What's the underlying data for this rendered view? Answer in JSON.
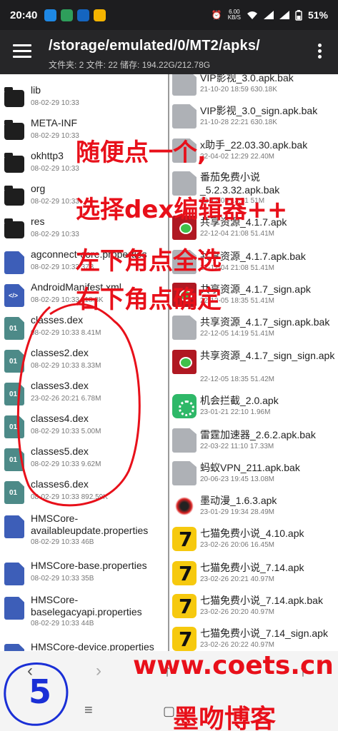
{
  "status_bar": {
    "time": "20:40",
    "speed_value": "6.00",
    "speed_unit": "KB/S",
    "battery": "51%"
  },
  "app_bar": {
    "path": "/storage/emulated/0/MT2/apks/",
    "info": "文件夹: 2  文件: 22  储存: 194.22G/212.78G"
  },
  "left_pane": {
    "items": [
      {
        "name": "lib",
        "meta": "08-02-29 10:33",
        "icon": "folder-icon"
      },
      {
        "name": "META-INF",
        "meta": "08-02-29 10:33",
        "icon": "folder-icon"
      },
      {
        "name": "okhttp3",
        "meta": "08-02-29 10:33",
        "icon": "folder-icon"
      },
      {
        "name": "org",
        "meta": "08-02-29 10:33",
        "icon": "folder-icon"
      },
      {
        "name": "res",
        "meta": "08-02-29 10:33",
        "icon": "folder-icon"
      },
      {
        "name": "agconnect-core.properties",
        "meta": "08-02-29 10:33  37B",
        "icon": "properties-file-icon"
      },
      {
        "name": "AndroidManifest.xml",
        "meta": "08-02-29 10:33  118.8K",
        "icon": "xml-file-icon"
      },
      {
        "name": "classes.dex",
        "meta": "08-02-29 10:33  8.41M",
        "icon": "dex-file-icon"
      },
      {
        "name": "classes2.dex",
        "meta": "08-02-29 10:33  8.33M",
        "icon": "dex-file-icon"
      },
      {
        "name": "classes3.dex",
        "meta": "23-02-26 20:21  6.78M",
        "icon": "dex-file-icon"
      },
      {
        "name": "classes4.dex",
        "meta": "08-02-29 10:33  5.00M",
        "icon": "dex-file-icon"
      },
      {
        "name": "classes5.dex",
        "meta": "08-02-29 10:33  9.62M",
        "icon": "dex-file-icon"
      },
      {
        "name": "classes6.dex",
        "meta": "08-02-29 10:33  892.59K",
        "icon": "dex-file-icon"
      },
      {
        "name": "HMSCore-availableupdate.properties",
        "meta": "08-02-29 10:33  46B",
        "icon": "properties-file-icon"
      },
      {
        "name": "HMSCore-base.properties",
        "meta": "08-02-29 10:33  35B",
        "icon": "properties-file-icon"
      },
      {
        "name": "HMSCore-baselegacyapi.properties",
        "meta": "08-02-29 10:33  44B",
        "icon": "properties-file-icon"
      },
      {
        "name": "HMSCore-device.properties",
        "meta": "",
        "icon": "properties-file-icon"
      }
    ]
  },
  "right_pane": {
    "items": [
      {
        "name": "VIP影视_3.0.apk.bak",
        "meta": "21-10-20 18:59  630.18K",
        "icon": "bak-file-icon"
      },
      {
        "name": "VIP影视_3.0_sign.apk.bak",
        "meta": "21-10-28 22:21  630.18K",
        "icon": "bak-file-icon"
      },
      {
        "name": "x助手_22.03.30.apk.bak",
        "meta": "22-04-02 12:29  22.40M",
        "icon": "bak-file-icon"
      },
      {
        "name": "番茄免费小说_5.2.3.32.apk.bak",
        "meta": "22-12-05 13:51  51M",
        "icon": "bak-file-icon"
      },
      {
        "name": "共享资源_4.1.7.apk",
        "meta": "22-12-04 21:08  51.41M",
        "icon": "share-app-icon"
      },
      {
        "name": "共享资源_4.1.7.apk.bak",
        "meta": "22-12-04 21:08  51.41M",
        "icon": "bak-file-icon"
      },
      {
        "name": "共享资源_4.1.7_sign.apk",
        "meta": "22-12-05 18:35  51.41M",
        "icon": "share-app-icon"
      },
      {
        "name": "共享资源_4.1.7_sign.apk.bak",
        "meta": "22-12-05 14:19  51.41M",
        "icon": "bak-file-icon"
      },
      {
        "name": "共享资源_4.1.7_sign_sign.apk",
        "meta": "22-12-05 18:35  51.42M",
        "icon": "share-app-icon"
      },
      {
        "name": "机会拦截_2.0.apk",
        "meta": "23-01-21 22:10  1.96M",
        "icon": "intercept-app-icon"
      },
      {
        "name": "雷霆加速器_2.6.2.apk.bak",
        "meta": "22-03-22 11:10  17.33M",
        "icon": "bak-file-icon"
      },
      {
        "name": "蚂蚁VPN_211.apk.bak",
        "meta": "20-06-23 19:45  13.08M",
        "icon": "bak-file-icon"
      },
      {
        "name": "墨动漫_1.6.3.apk",
        "meta": "23-01-29 19:34  28.49M",
        "icon": "ink-comic-app-icon"
      },
      {
        "name": "七猫免费小说_4.10.apk",
        "meta": "23-02-26 20:06  16.45M",
        "icon": "qimao-app-icon"
      },
      {
        "name": "七猫免费小说_7.14.apk",
        "meta": "23-02-26 20:21  40.97M",
        "icon": "qimao-app-icon"
      },
      {
        "name": "七猫免费小说_7.14.apk.bak",
        "meta": "23-02-26 20:20  40.97M",
        "icon": "qimao-app-icon"
      },
      {
        "name": "七猫免费小说_7.14_sign.apk",
        "meta": "23-02-26 20:22  40.97M",
        "icon": "qimao-app-icon"
      }
    ]
  },
  "annotations": {
    "line1": "随便点一个,",
    "line2": "选择dex编辑器++",
    "line3": "左下角点全选",
    "line4": "右下角点确定",
    "circled_number": "5"
  },
  "watermark": {
    "url": "www.coets.cn",
    "name": "墨吻博客"
  },
  "colors": {
    "annotation_red": "#e8101a",
    "app_bar": "#262628",
    "status_bar": "#1d1d1f"
  }
}
